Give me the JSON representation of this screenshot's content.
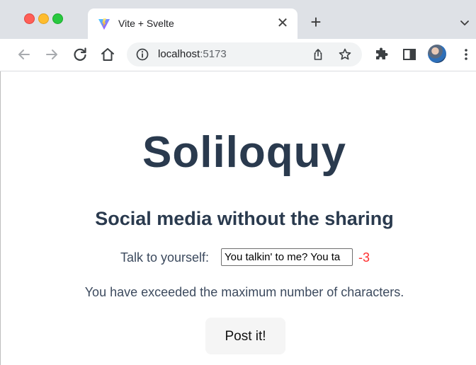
{
  "browser": {
    "tab": {
      "title": "Vite + Svelte",
      "favicon": "vite-icon",
      "close_glyph": "✕"
    },
    "new_tab_glyph": "+",
    "address": {
      "host": "localhost",
      "port": ":5173"
    },
    "icons": [
      "back-icon",
      "forward-icon",
      "reload-icon",
      "home-icon",
      "info-icon",
      "share-icon",
      "star-icon",
      "extensions-icon",
      "side-panel-icon",
      "profile-avatar",
      "menu-icon"
    ]
  },
  "page": {
    "title": "Soliloquy",
    "tagline": "Social media without the sharing",
    "talk_label": "Talk to yourself:",
    "input_value": "You talkin' to me? You ta",
    "remaining_count": "-3",
    "warning": "You have exceeded the maximum number of characters.",
    "post_button": "Post it!"
  },
  "colors": {
    "heading": "#2a3a4e",
    "count_negative": "#ff2e2e",
    "tabstrip": "#dee1e6"
  }
}
